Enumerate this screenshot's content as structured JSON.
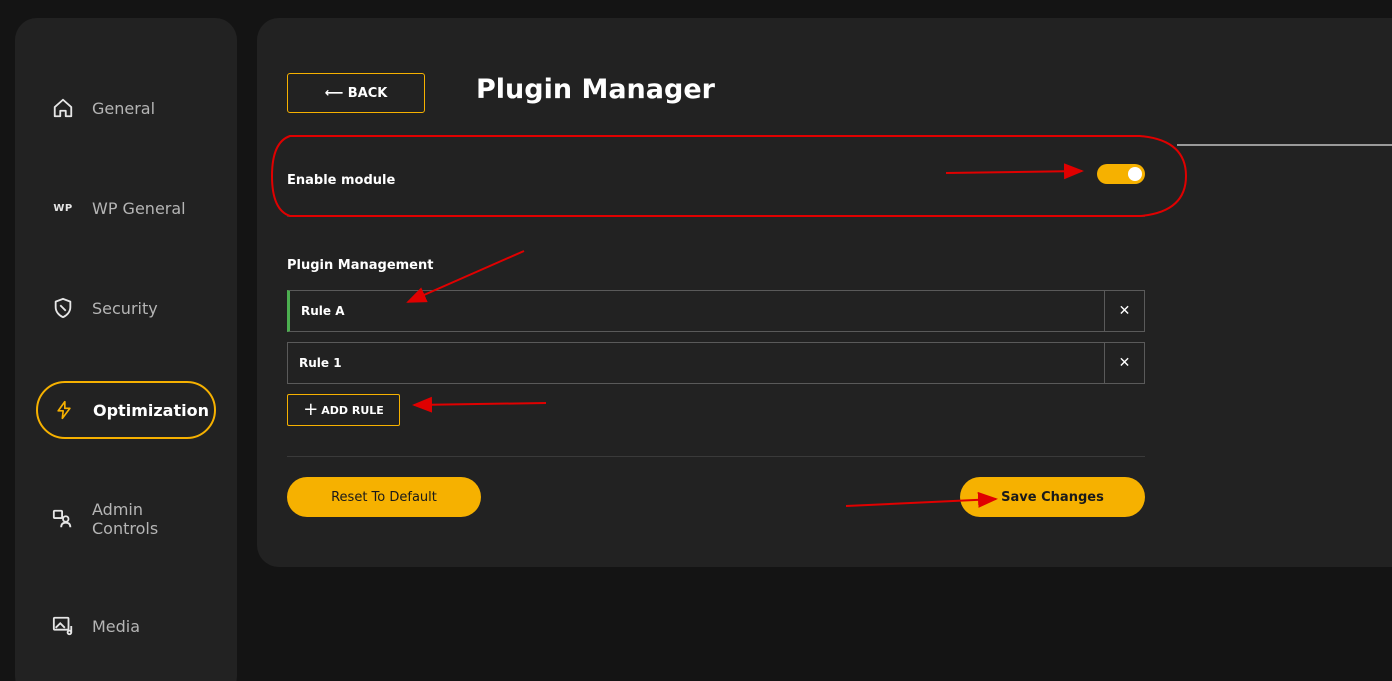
{
  "sidebar": {
    "items": [
      {
        "label": "General",
        "icon": "home-icon"
      },
      {
        "label": "WP General",
        "icon": "wp-icon",
        "icon_text": "WP"
      },
      {
        "label": "Security",
        "icon": "shield-icon"
      },
      {
        "label": "Optimization",
        "icon": "lightning-icon",
        "active": true
      },
      {
        "label": "Admin Controls",
        "icon": "admin-user-icon"
      },
      {
        "label": "Media",
        "icon": "media-icon"
      }
    ]
  },
  "header": {
    "back_label": "⟵ BACK",
    "title": "Plugin Manager"
  },
  "module": {
    "enable_label": "Enable module",
    "enabled": true
  },
  "plugin_management": {
    "label": "Plugin Management",
    "rules": [
      {
        "name": "Rule A",
        "selected": true
      },
      {
        "name": "Rule 1",
        "selected": false
      }
    ],
    "delete_symbol": "✕",
    "add_rule_label": "ADD RULE",
    "add_symbol": "+"
  },
  "actions": {
    "reset_label": "Reset To Default",
    "save_label": "Save Changes"
  },
  "colors": {
    "accent": "#f6b100",
    "background": "#141414",
    "panel": "#222222",
    "selected_marker": "#4caf50",
    "annotation": "#e00000"
  }
}
